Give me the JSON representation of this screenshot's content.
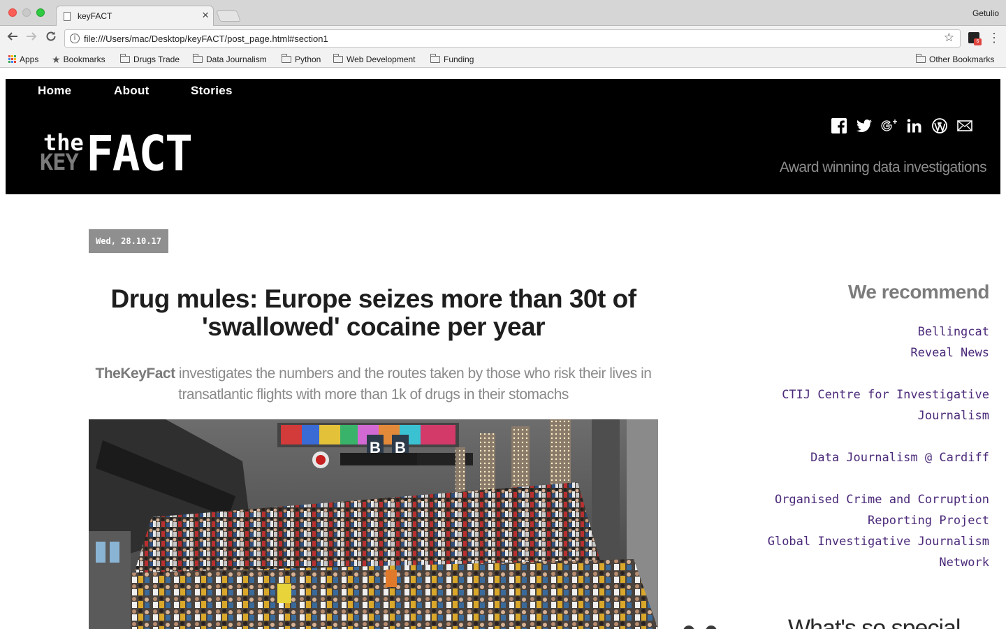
{
  "browser": {
    "tab_title": "keyFACT",
    "tab_close": "×",
    "profile": "Getulio",
    "url": "file:///Users/mac/Desktop/keyFACT/post_page.html#section1",
    "extension_badge": "6",
    "bookmarks": [
      {
        "label": "Apps",
        "icon": "apps-grid-icon"
      },
      {
        "label": "Bookmarks",
        "icon": "star-icon"
      },
      {
        "label": "Drugs Trade",
        "icon": "folder-icon"
      },
      {
        "label": "Data Journalism",
        "icon": "folder-icon"
      },
      {
        "label": "Python",
        "icon": "folder-icon"
      },
      {
        "label": "Web Development",
        "icon": "folder-icon"
      },
      {
        "label": "Funding",
        "icon": "folder-icon"
      }
    ],
    "other_bookmarks": "Other Bookmarks"
  },
  "site": {
    "nav": [
      "Home",
      "About",
      "Stories"
    ],
    "logo": {
      "the": "the",
      "key": "KEY",
      "fact": "FACT"
    },
    "social_icons": [
      "facebook-icon",
      "twitter-icon",
      "google-plus-icon",
      "linkedin-icon",
      "wordpress-icon",
      "email-icon"
    ],
    "tagline": "Award winning data investigations"
  },
  "article": {
    "date": "Wed, 28.10.17",
    "headline": "Drug mules: Europe seizes more than 30t of 'swallowed' cocaine per year",
    "standfirst_brand": "TheKeyFact",
    "standfirst_text": " investigates the numbers and the routes taken by those who risk their lives in transatlantic flights with more than 1k of drugs in their stomachs",
    "image_alt": "Crowded airport terminal"
  },
  "sidebar": {
    "title": "We recommend",
    "links": [
      "Bellingcat",
      "Reveal News",
      "CTIJ Centre for Investigative",
      "Journalism",
      "Data Journalism @ Cardiff",
      "Organised Crime and Corruption",
      "Reporting Project",
      "Global Investigative Journalism",
      "Network"
    ],
    "next_heading": "What's so special"
  },
  "colors": {
    "header_bg": "#000000",
    "link_purple": "#4b2a7a",
    "date_badge": "#8f8f8f"
  }
}
